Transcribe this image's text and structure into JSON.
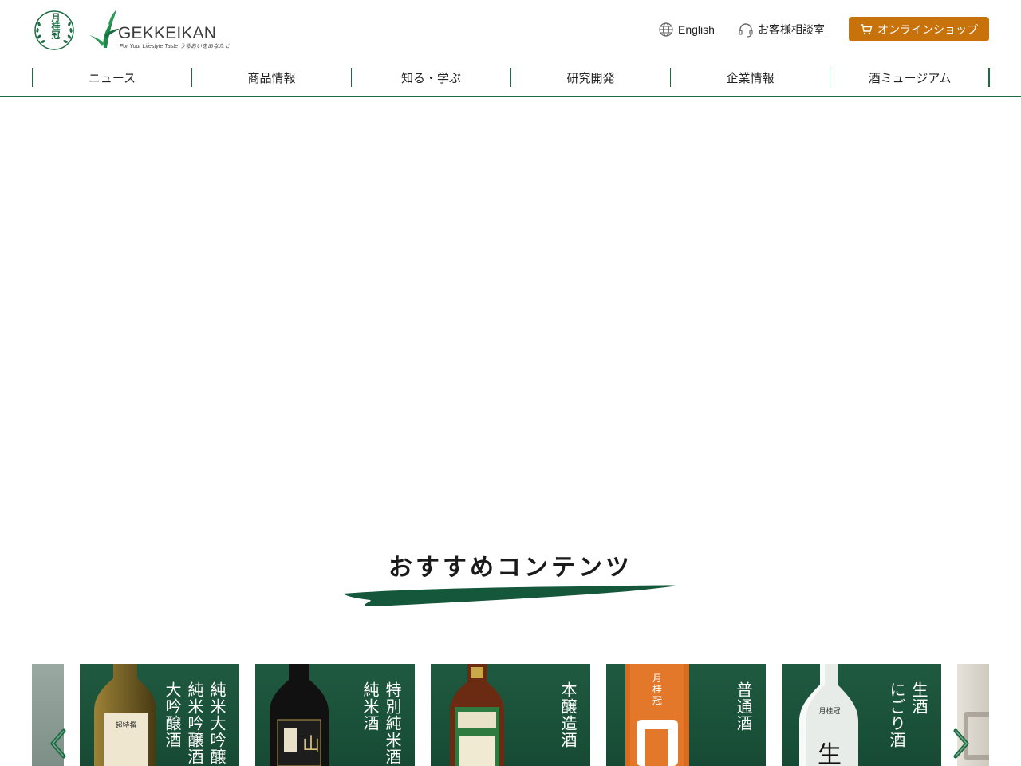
{
  "header": {
    "emblem_text": "月桂冠",
    "brand_name": "GEKKEIKAN",
    "brand_tagline": "For Your Lifestyle Taste うるおいをあなたと",
    "english_label": "English",
    "support_label": "お客様相談室",
    "shop_label": "オンラインショップ",
    "shop_color": "#c8720b"
  },
  "nav": {
    "items": [
      {
        "label": "ニュース"
      },
      {
        "label": "商品情報"
      },
      {
        "label": "知る・学ぶ"
      },
      {
        "label": "研究開発"
      },
      {
        "label": "企業情報"
      },
      {
        "label": "酒ミュージアム"
      }
    ],
    "accent_color": "#1b6b43"
  },
  "recommend": {
    "title": "おすすめコンテンツ",
    "cards": [
      {
        "label": "純米大吟醸\n純米吟醸酒\n大吟醸酒",
        "icon": "daiginjo-bottle"
      },
      {
        "label": "特別純米酒\n純米酒",
        "icon": "junmai-bottle"
      },
      {
        "label": "本醸造酒",
        "icon": "honjozo-bottle"
      },
      {
        "label": "普通酒",
        "icon": "futsu-pack"
      },
      {
        "label": "生酒\nにごり酒",
        "icon": "namazake-bottle"
      }
    ],
    "prev_icon": "chevron-left-icon",
    "next_icon": "chevron-right-icon"
  }
}
